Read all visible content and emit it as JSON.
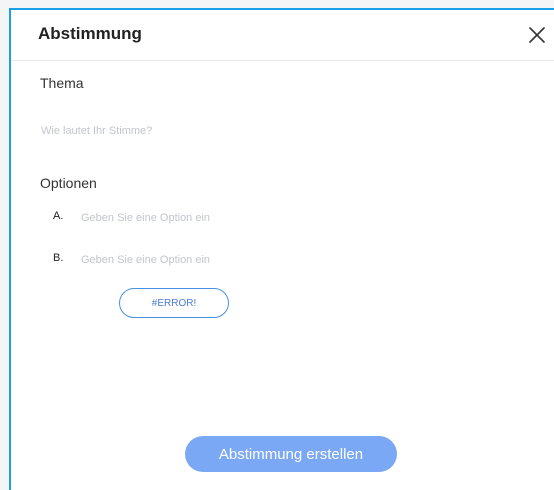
{
  "dialog": {
    "title": "Abstimmung",
    "close_icon": "close-icon"
  },
  "topic": {
    "label": "Thema",
    "placeholder": "Wie lautet Ihr Stimme?",
    "value": ""
  },
  "options": {
    "label": "Optionen",
    "items": [
      {
        "letter": "A.",
        "placeholder": "Geben Sie eine Option ein",
        "value": ""
      },
      {
        "letter": "B.",
        "placeholder": "Geben Sie eine Option ein",
        "value": ""
      }
    ],
    "add_button_label": "#ERROR!"
  },
  "footer": {
    "create_button_label": "Abstimmung erstellen"
  },
  "colors": {
    "accent": "#7aa8f4",
    "border_blue": "#1aa0e8",
    "add_button_border": "#4a90e2"
  }
}
